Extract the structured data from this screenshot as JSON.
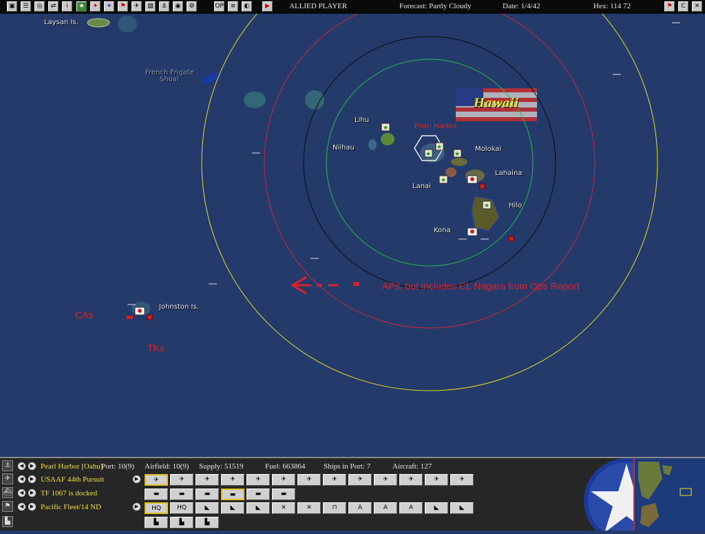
{
  "toolbar": {
    "buttons": [
      "▣",
      "☰",
      "◎",
      "⇄",
      "i",
      "★",
      "✦",
      "✦",
      "⚑",
      "✈",
      "▧",
      "⚓",
      "◉",
      "⚙",
      "OP",
      "≡",
      "◐",
      "▶"
    ],
    "player": "ALLIED PLAYER",
    "forecast": "Forecast: Partly Cloudy",
    "date": "Date: 1/4/42",
    "hex": "Hex: 114  72",
    "right_buttons": [
      "⚑",
      "C",
      "✕"
    ]
  },
  "map": {
    "labels": {
      "laysan": "Laysan Is.",
      "french_frigate": "French Frigate",
      "french_frigate_2": "Shoal",
      "lihu": "Lihu",
      "niihau": "Niihau",
      "pearl_harbor": "Pearl Harbor",
      "molokai": "Molokai",
      "lanai": "Lanai",
      "lahaina": "Lahaina",
      "hilo": "Hilo",
      "kona": "Kona",
      "johnston": "Johnston Is.",
      "hawaii": "Hawaii"
    },
    "annotations": {
      "aps_note": "APs, but includes CL Nagara from Ops Report",
      "cas": "CAs",
      "tks": "TKs"
    },
    "ring_colors": {
      "yellow": "#e8e020",
      "red": "#d02838",
      "black": "#0a0a0a",
      "green": "#20c040"
    }
  },
  "panel": {
    "rows": [
      {
        "icon": "anchor-icon",
        "text": "Pearl Harbor [Oahu]"
      },
      {
        "icon": "plane-icon",
        "text": "USAAF 44th Pursuit"
      },
      {
        "icon": "ship-icon",
        "text": "TF 1067 is docked"
      },
      {
        "icon": "flag-icon",
        "text": "Pacific Fleet/14 ND"
      }
    ],
    "info": {
      "port": "Port: 10(9)",
      "airfield": "Airfield: 10(9)",
      "supply": "Supply: 51519",
      "fuel": "Fuel: 663864",
      "ships": "Ships in Port: 7",
      "aircraft": "Aircraft: 127"
    },
    "hq_labels": [
      "HQ",
      "HQ"
    ]
  }
}
